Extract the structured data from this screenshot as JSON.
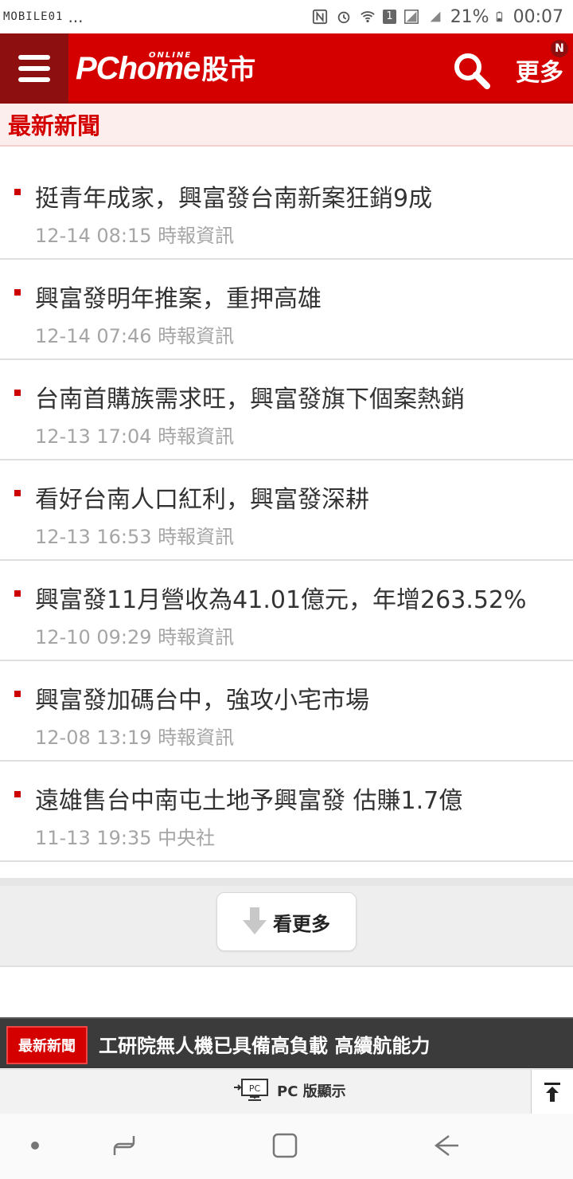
{
  "status_bar": {
    "watermark": "MOBILE01",
    "ellipsis": "...",
    "sim_badge": "1",
    "battery": "21%",
    "time": "00:07"
  },
  "header": {
    "logo_main": "PChome",
    "logo_online": "ONLINE",
    "logo_cn": "股市",
    "more_label": "更多",
    "badge": "N",
    "accent_color": "#d40000"
  },
  "section": {
    "title": "最新新聞"
  },
  "news": [
    {
      "title": "挺青年成家，興富發台南新案狂銷9成",
      "meta": "12-14 08:15 時報資訊"
    },
    {
      "title": "興富發明年推案，重押高雄",
      "meta": "12-14 07:46 時報資訊"
    },
    {
      "title": "台南首購族需求旺，興富發旗下個案熱銷",
      "meta": "12-13 17:04 時報資訊"
    },
    {
      "title": "看好台南人口紅利，興富發深耕",
      "meta": "12-13 16:53 時報資訊"
    },
    {
      "title": "興富發11月營收為41.01億元，年增263.52%",
      "meta": "12-10 09:29 時報資訊"
    },
    {
      "title": "興富發加碼台中，強攻小宅市場",
      "meta": "12-08 13:19 時報資訊"
    },
    {
      "title": "遠雄售台中南屯土地予興富發 估賺1.7億",
      "meta": "11-13 19:35 中央社"
    }
  ],
  "see_more": {
    "label": "看更多"
  },
  "ticker": {
    "tag": "最新新聞",
    "headline": "工研院無人機已具備高負載 高續航能力"
  },
  "pc_bar": {
    "icon_text": "PC",
    "label": "PC 版顯示"
  }
}
